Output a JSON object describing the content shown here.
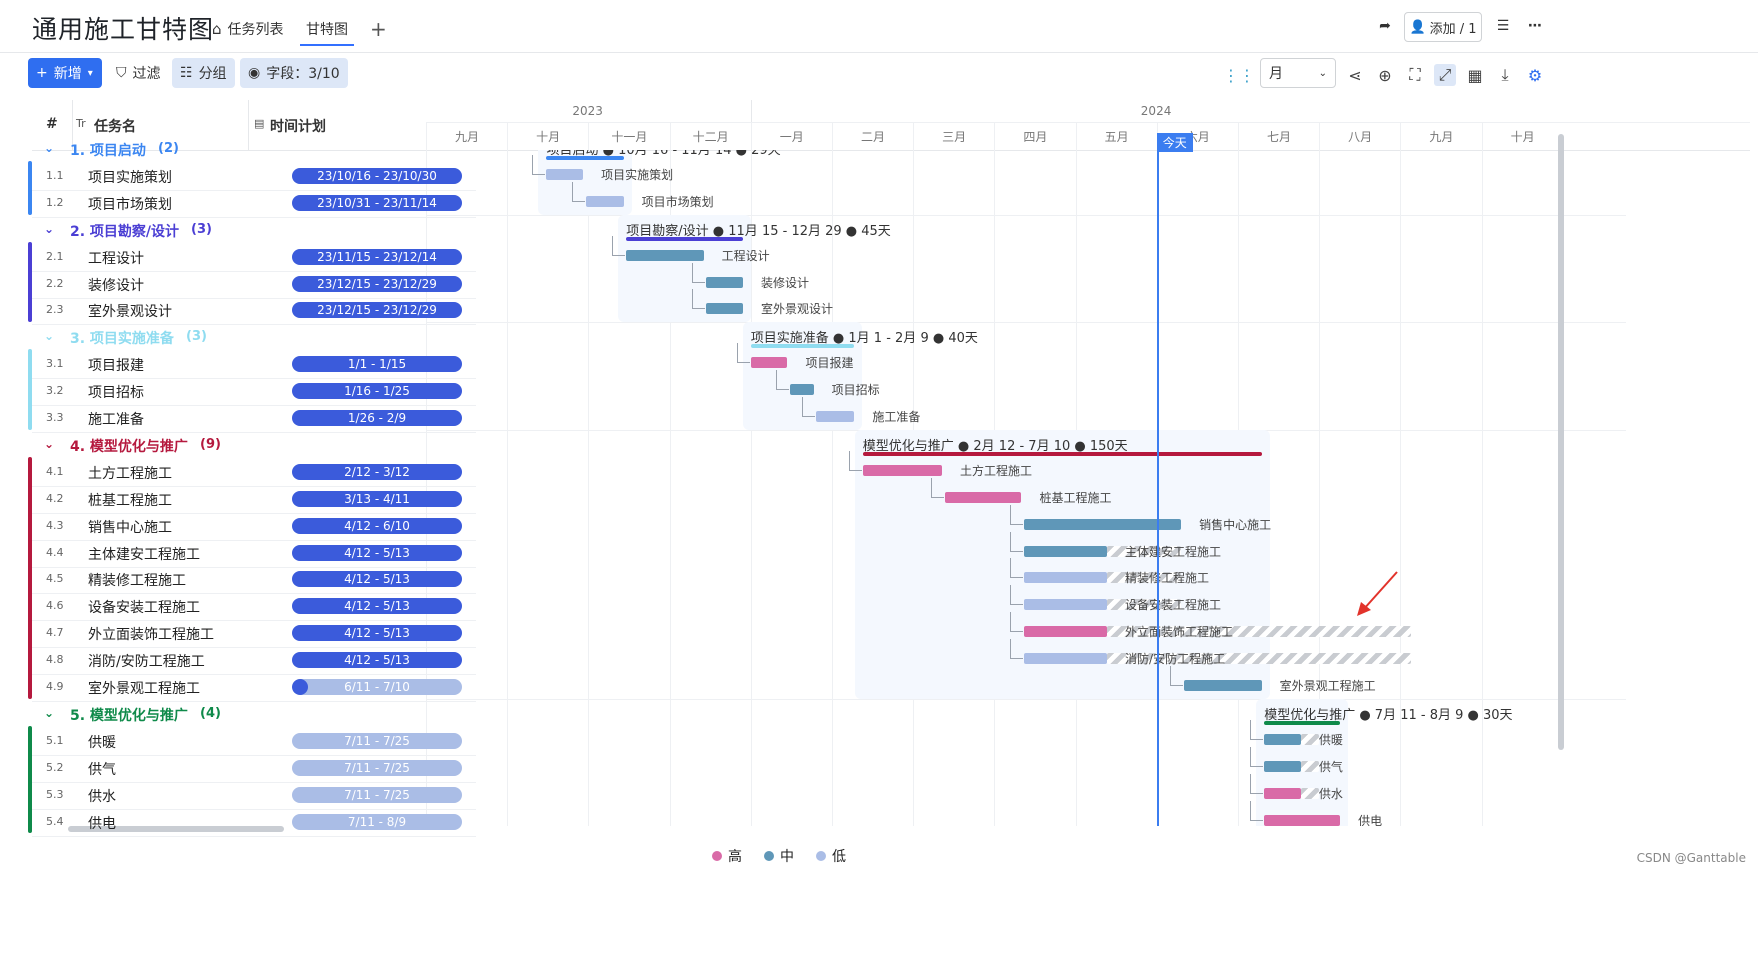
{
  "header": {
    "title": "通用施工甘特图",
    "tabs": [
      {
        "label": "任务列表",
        "icon": "home-icon"
      },
      {
        "label": "甘特图",
        "active": true
      }
    ],
    "add_tab": "+",
    "add_member_label": "添加 / 1"
  },
  "toolbar": {
    "new_label": "新增",
    "filter_label": "过滤",
    "group_label": "分组",
    "fields_label": "字段：3/10",
    "scale_value": "月"
  },
  "table": {
    "col_num": "#",
    "col_name": "任务名",
    "col_plan": "时间计划",
    "name_prefix": "Tr",
    "groups": [
      {
        "title": "1. 项目启动",
        "count": "(2)",
        "color": "#3b86f1",
        "rows": [
          {
            "num": "1.1",
            "name": "项目实施策划",
            "plan": "23/10/16 - 23/10/30"
          },
          {
            "num": "1.2",
            "name": "项目市场策划",
            "plan": "23/10/31 - 23/11/14"
          }
        ]
      },
      {
        "title": "2. 项目勘察/设计",
        "count": "(3)",
        "color": "#4b3fd4",
        "rows": [
          {
            "num": "2.1",
            "name": "工程设计",
            "plan": "23/11/15 - 23/12/14"
          },
          {
            "num": "2.2",
            "name": "装修设计",
            "plan": "23/12/15 - 23/12/29"
          },
          {
            "num": "2.3",
            "name": "室外景观设计",
            "plan": "23/12/15 - 23/12/29"
          }
        ]
      },
      {
        "title": "3. 项目实施准备",
        "count": "(3)",
        "color": "#8fdcf0",
        "rows": [
          {
            "num": "3.1",
            "name": "项目报建",
            "plan": "1/1 - 1/15"
          },
          {
            "num": "3.2",
            "name": "项目招标",
            "plan": "1/16 - 1/25"
          },
          {
            "num": "3.3",
            "name": "施工准备",
            "plan": "1/26 - 2/9"
          }
        ]
      },
      {
        "title": "4. 模型优化与推广",
        "count": "(9)",
        "color": "#b5193e",
        "rows": [
          {
            "num": "4.1",
            "name": "土方工程施工",
            "plan": "2/12 - 3/12"
          },
          {
            "num": "4.2",
            "name": "桩基工程施工",
            "plan": "3/13 - 4/11"
          },
          {
            "num": "4.3",
            "name": "销售中心施工",
            "plan": "4/12 - 6/10"
          },
          {
            "num": "4.4",
            "name": "主体建安工程施工",
            "plan": "4/12 - 5/13"
          },
          {
            "num": "4.5",
            "name": "精装修工程施工",
            "plan": "4/12 - 5/13"
          },
          {
            "num": "4.6",
            "name": "设备安装工程施工",
            "plan": "4/12 - 5/13"
          },
          {
            "num": "4.7",
            "name": "外立面装饰工程施工",
            "plan": "4/12 - 5/13"
          },
          {
            "num": "4.8",
            "name": "消防/安防工程施工",
            "plan": "4/12 - 5/13"
          },
          {
            "num": "4.9",
            "name": "室外景观工程施工",
            "plan": "6/11 - 7/10"
          }
        ]
      },
      {
        "title": "5. 模型优化与推广",
        "count": "(4)",
        "color": "#0f8a4a",
        "rows": [
          {
            "num": "5.1",
            "name": "供暖",
            "plan": "7/11 - 7/25"
          },
          {
            "num": "5.2",
            "name": "供气",
            "plan": "7/11 - 7/25"
          },
          {
            "num": "5.3",
            "name": "供水",
            "plan": "7/11 - 7/25"
          },
          {
            "num": "5.4",
            "name": "供电",
            "plan": "7/11 - 8/9"
          }
        ]
      }
    ]
  },
  "gantt": {
    "years": [
      "2023",
      "2024"
    ],
    "months": [
      "九月",
      "十月",
      "十一月",
      "十二月",
      "一月",
      "二月",
      "三月",
      "四月",
      "五月",
      "六月",
      "七月",
      "八月",
      "九月",
      "十月"
    ],
    "today_label": "今天",
    "group_summaries": [
      "项目启动 ● 10月 16 - 11月 14 ● 29天",
      "项目勘察/设计 ● 11月 15 - 12月 29 ● 45天",
      "项目实施准备 ● 1月 1 - 2月 9 ● 40天",
      "模型优化与推广 ● 2月 12 - 7月 10 ● 150天",
      "模型优化与推广 ● 7月 11 - 8月 9 ● 30天"
    ],
    "bar_labels": [
      "项目实施策划",
      "项目市场策划",
      "工程设计",
      "装修设计",
      "室外景观设计",
      "项目报建",
      "项目招标",
      "施工准备",
      "土方工程施工",
      "桩基工程施工",
      "销售中心施工",
      "主体建安工程施工",
      "精装修工程施工",
      "设备安装工程施工",
      "外立面装饰工程施工",
      "消防/安防工程施工",
      "室外景观工程施工",
      "供暖",
      "供气",
      "供水",
      "供电"
    ]
  },
  "legend": [
    {
      "label": "高",
      "color": "#d96aa7"
    },
    {
      "label": "中",
      "color": "#5f97b8"
    },
    {
      "label": "低",
      "color": "#aabde6"
    }
  ],
  "watermark": "CSDN @Ganttable"
}
